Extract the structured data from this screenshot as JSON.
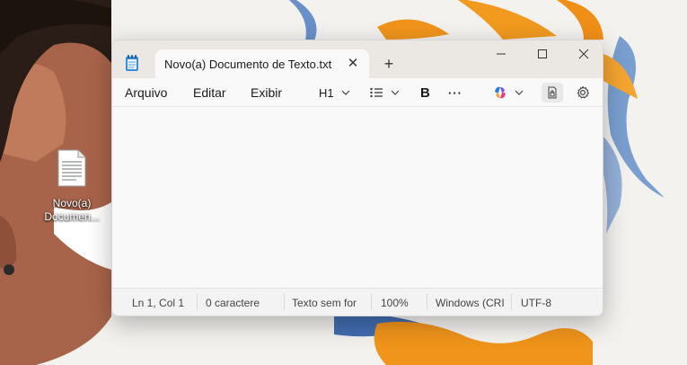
{
  "desktop": {
    "icon_label": "Novo(a) Documen...",
    "icon_label_line1": "Novo(a)",
    "icon_label_line2": "Documen..."
  },
  "window": {
    "tab_title": "Novo(a) Documento de Texto.txt",
    "new_tab_symbol": "+",
    "close_tab_symbol": "✕"
  },
  "menu": {
    "file": "Arquivo",
    "edit": "Editar",
    "view": "Exibir"
  },
  "toolbar": {
    "heading": "H1",
    "bold": "B",
    "more": "···"
  },
  "statusbar": {
    "position": "Ln 1, Col 1",
    "chars": "0 caractere",
    "format": "Texto sem for",
    "zoom": "100%",
    "line_ending": "Windows (CRI",
    "encoding": "UTF-8"
  },
  "colors": {
    "titlebar": "#ebe8e4",
    "editor": "#f9f9f9",
    "accent_orange": "#f0941b",
    "accent_blue": "#4a7fc0"
  },
  "icons": [
    "notepad-icon",
    "close-icon",
    "plus-icon",
    "minimize-icon",
    "maximize-icon",
    "chevron-down-icon",
    "list-icon",
    "copilot-icon",
    "document-lock-icon",
    "gear-icon",
    "text-file-icon"
  ]
}
